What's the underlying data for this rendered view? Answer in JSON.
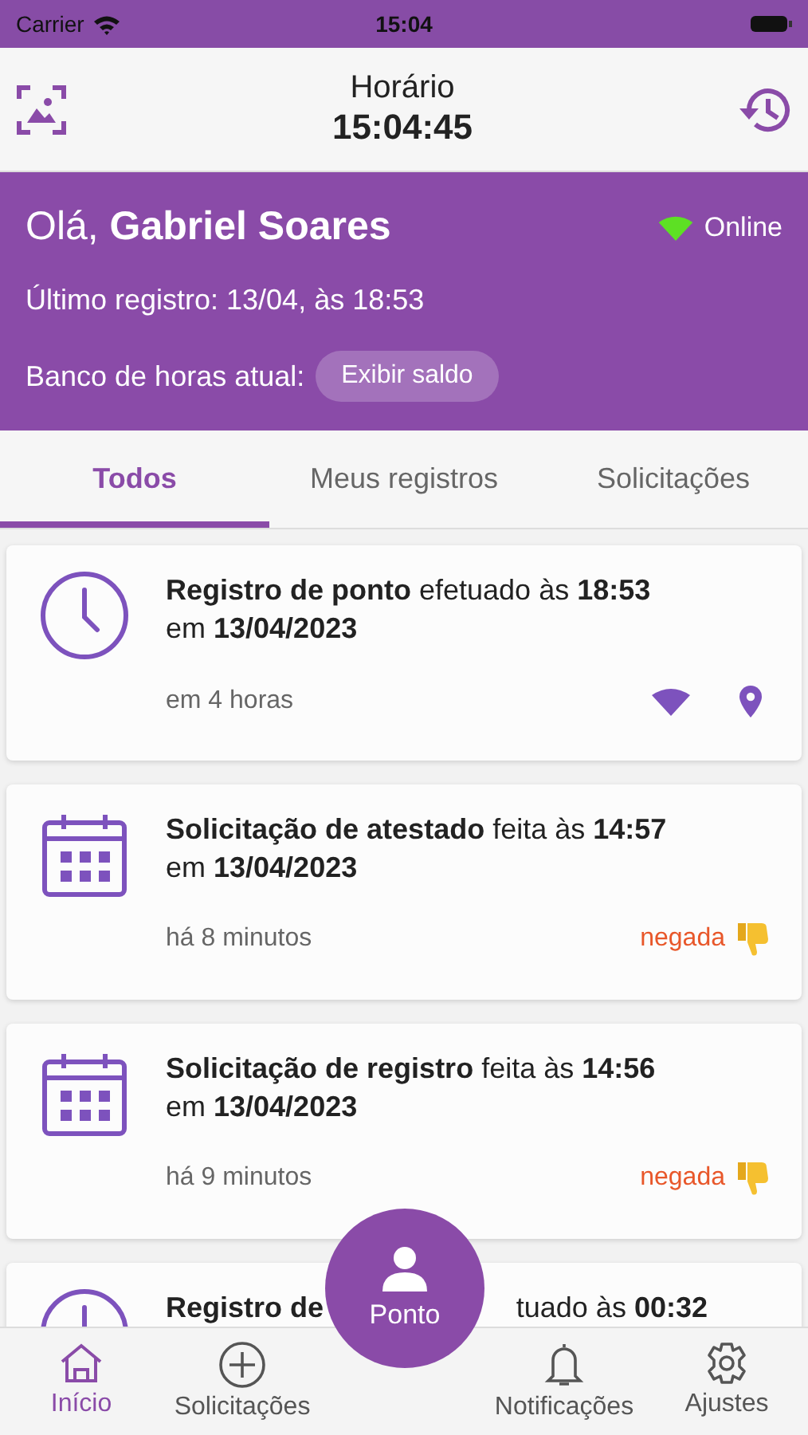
{
  "status_bar": {
    "carrier": "Carrier",
    "time": "15:04"
  },
  "header": {
    "title": "Horário",
    "clock": "15:04:45"
  },
  "banner": {
    "greeting": "Olá, **Gabriel Soares**",
    "connection": "Online",
    "online": true,
    "last_record": "Último registro: 13/04, às 18:53",
    "balance_label": "Banco de horas atual:",
    "balance_button": "Exibir saldo"
  },
  "tabs": [
    {
      "label": "Todos",
      "selected": true
    },
    {
      "label": "Meus registros",
      "selected": false
    },
    {
      "label": "Solicitações",
      "selected": false
    }
  ],
  "cards": [
    {
      "kind": "record",
      "title": "**Registro de ponto** efetuado às **18:53**",
      "date": "em **13/04/2023**",
      "time_ago": "em 4 horas"
    },
    {
      "kind": "request",
      "title": "**Solicitação de atestado** feita às **14:57**",
      "date": "em **13/04/2023**",
      "time_ago": "há 8 minutos",
      "status": "negada"
    },
    {
      "kind": "request",
      "title": "**Solicitação de registro** feita às **14:56**",
      "date": "em **13/04/2023**",
      "time_ago": "há 9 minutos",
      "status": "negada"
    },
    {
      "kind": "partial",
      "title_parts": [
        "**Registro de**",
        "tuado às **00:32**"
      ]
    }
  ],
  "fab": {
    "label": "Ponto"
  },
  "tab_bar": [
    {
      "label": "Início",
      "selected": true
    },
    {
      "label": "Solicitações",
      "selected": false
    },
    {
      "label": "Notificações",
      "selected": false
    },
    {
      "label": "Ajustes",
      "selected": false
    }
  ]
}
